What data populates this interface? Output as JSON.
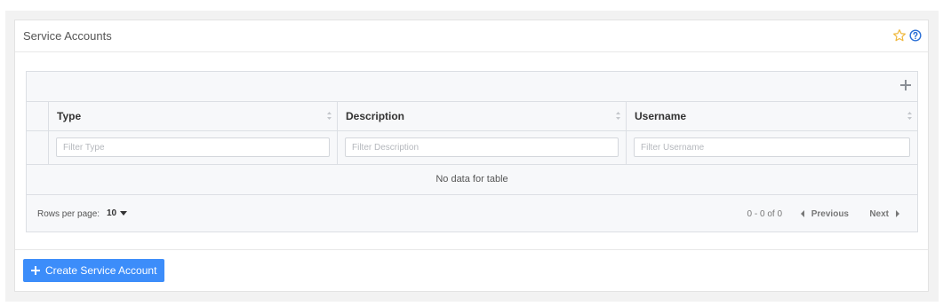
{
  "panel": {
    "title": "Service Accounts",
    "star_icon": "star-outline-icon",
    "help_icon": "question-circle-icon",
    "accent_color": "#f0b83c",
    "help_color": "#2b6fd6"
  },
  "table": {
    "toolbar": {
      "add_icon": "plus-icon"
    },
    "columns": [
      {
        "label": "Type",
        "filter_placeholder": "Filter Type"
      },
      {
        "label": "Description",
        "filter_placeholder": "Filter Description"
      },
      {
        "label": "Username",
        "filter_placeholder": "Filter Username"
      }
    ],
    "empty_message": "No data for table",
    "footer": {
      "rows_per_page_label": "Rows per page:",
      "rows_per_page_value": "10",
      "range": "0 - 0 of 0",
      "previous_label": "Previous",
      "next_label": "Next"
    }
  },
  "actions": {
    "create_label": "Create Service Account",
    "create_color": "#3c8dfa"
  }
}
